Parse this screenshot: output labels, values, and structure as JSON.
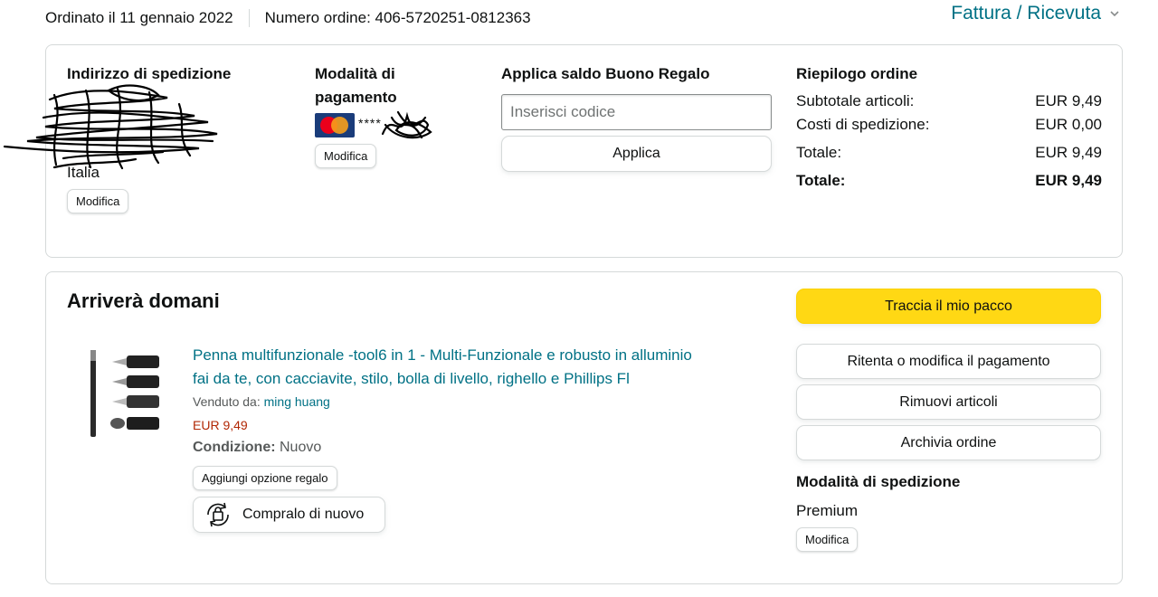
{
  "header": {
    "ordered_on": "Ordinato il 11 gennaio 2022",
    "order_number": "Numero ordine: 406-5720251-0812363",
    "invoice_label": "Fattura / Ricevuta"
  },
  "shipping_address": {
    "heading": "Indirizzo di spedizione",
    "country": "Italia",
    "edit_label": "Modifica"
  },
  "payment": {
    "heading": "Modalità di pagamento",
    "card_mask": "****",
    "edit_label": "Modifica"
  },
  "gift_card": {
    "heading": "Applica saldo Buono Regalo",
    "placeholder": "Inserisci codice",
    "apply_label": "Applica"
  },
  "order_summary": {
    "heading": "Riepilogo ordine",
    "rows": [
      {
        "label": "Subtotale articoli:",
        "value": "EUR 9,49"
      },
      {
        "label": "Costi di spedizione:",
        "value": "EUR 0,00"
      },
      {
        "label": "Totale:",
        "value": "EUR 9,49"
      }
    ],
    "grand_total": {
      "label": "Totale:",
      "value": "EUR 9,49"
    }
  },
  "shipment": {
    "heading": "Arriverà domani",
    "item": {
      "title_line1": "Penna multifunzionale -tool6 in 1 - Multi-Funzionale e robusto in alluminio",
      "title_line2": "fai da te, con cacciavite, stilo, bolla di livello, righello e Phillips Fl",
      "sold_by_label": "Venduto da:",
      "seller": "ming huang",
      "price": "EUR 9,49",
      "condition_label": "Condizione:",
      "condition_value": "Nuovo",
      "gift_option_label": "Aggiungi opzione regalo",
      "buy_again_label": "Compralo di nuovo"
    },
    "actions": {
      "track": "Traccia il mio pacco",
      "retry_payment": "Ritenta o modifica il pagamento",
      "remove_items": "Rimuovi articoli",
      "archive": "Archivia ordine"
    },
    "shipping_method": {
      "heading": "Modalità di spedizione",
      "value": "Premium",
      "edit_label": "Modifica"
    }
  },
  "colors": {
    "link": "#007185",
    "price": "#b12704",
    "primary_button": "#ffd814",
    "border": "#d5d9d9"
  }
}
